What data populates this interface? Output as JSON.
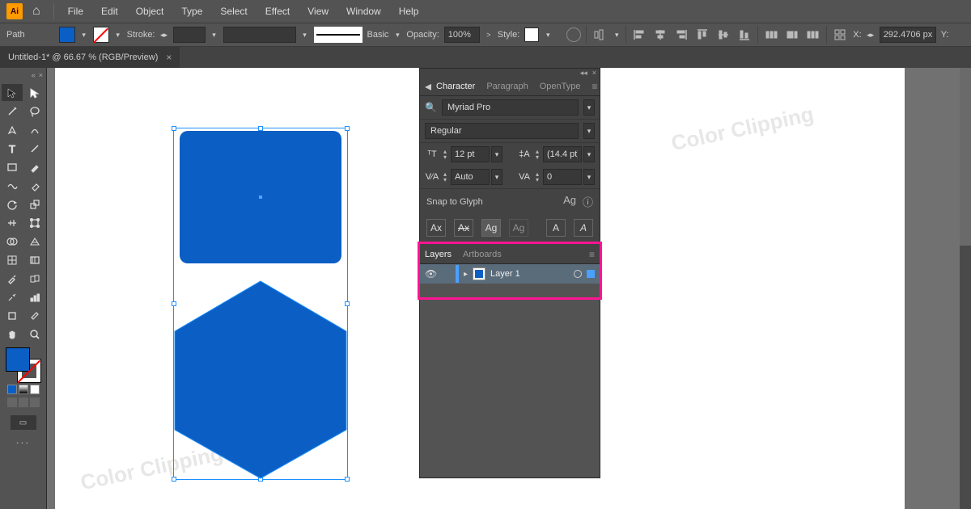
{
  "app": {
    "shortname": "Ai"
  },
  "menu": {
    "file": "File",
    "edit": "Edit",
    "object": "Object",
    "type": "Type",
    "select": "Select",
    "effect": "Effect",
    "view": "View",
    "window": "Window",
    "help": "Help"
  },
  "control": {
    "pathLabel": "Path",
    "strokeLabel": "Stroke:",
    "strokeWeight": "",
    "profileLabel": "Basic",
    "opacityLabel": "Opacity:",
    "opacityValue": "100%",
    "styleLabel": "Style:",
    "xLabel": "X:",
    "xValue": "292.4706 px",
    "yLabel": "Y:"
  },
  "doc": {
    "tab": "Untitled-1* @ 66.67 % (RGB/Preview)"
  },
  "charPanel": {
    "tabs": {
      "character": "Character",
      "paragraph": "Paragraph",
      "opentype": "OpenType"
    },
    "fontFamily": "Myriad Pro",
    "fontStyle": "Regular",
    "size": "12 pt",
    "leading": "(14.4 pt)",
    "kerning": "Auto",
    "tracking": "0",
    "snapLabel": "Snap to Glyph",
    "glyphBtns": {
      "a": "Ax",
      "b": "Ax",
      "c": "Ag",
      "d": "Ag",
      "e": "A",
      "f": "A"
    }
  },
  "layersPanel": {
    "tabs": {
      "layers": "Layers",
      "artboards": "Artboards"
    },
    "layer1": "Layer 1"
  },
  "watermarks": {
    "w1": "Color Clipping",
    "w2": "Color Clipping"
  },
  "toolbox": {
    "editLabel": "..."
  }
}
